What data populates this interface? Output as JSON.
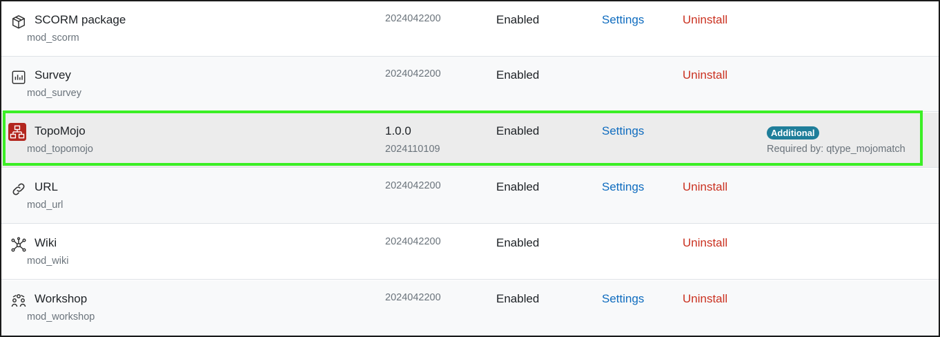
{
  "plugins": [
    {
      "name": "SCORM package",
      "component": "mod_scorm",
      "version": "2024042200",
      "status": "Enabled",
      "settings": "Settings",
      "uninstall": "Uninstall",
      "icon": "package-icon"
    },
    {
      "name": "Survey",
      "component": "mod_survey",
      "version": "2024042200",
      "status": "Enabled",
      "uninstall": "Uninstall",
      "icon": "survey-chart-icon"
    },
    {
      "name": "TopoMojo",
      "component": "mod_topomojo",
      "release": "1.0.0",
      "version": "2024110109",
      "status": "Enabled",
      "settings": "Settings",
      "badge": "Additional",
      "required_by": "Required by: qtype_mojomatch",
      "icon": "topomojo-network-icon"
    },
    {
      "name": "URL",
      "component": "mod_url",
      "version": "2024042200",
      "status": "Enabled",
      "settings": "Settings",
      "uninstall": "Uninstall",
      "icon": "link-icon"
    },
    {
      "name": "Wiki",
      "component": "mod_wiki",
      "version": "2024042200",
      "status": "Enabled",
      "uninstall": "Uninstall",
      "icon": "wiki-nodes-icon"
    },
    {
      "name": "Workshop",
      "component": "mod_workshop",
      "version": "2024042200",
      "status": "Enabled",
      "settings": "Settings",
      "uninstall": "Uninstall",
      "icon": "workshop-people-icon"
    }
  ],
  "colors": {
    "highlight_border": "#3bef25",
    "link": "#0f6cbf",
    "danger": "#ca3120",
    "badge": "#1f7e9a"
  }
}
